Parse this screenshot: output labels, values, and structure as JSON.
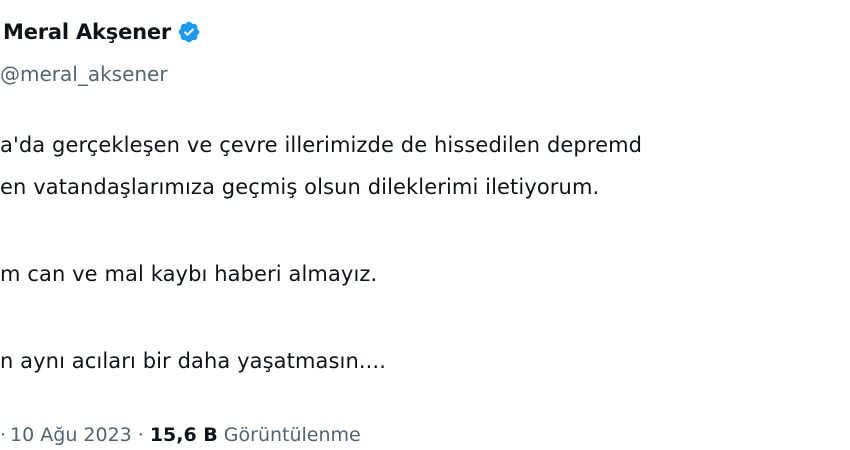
{
  "author": {
    "display_name": "Meral Akşener",
    "handle": "@meral_aksener",
    "verified_icon": "verified-badge-icon",
    "verified_color": "#1d9bf0"
  },
  "tweet": {
    "lines": [
      "a'da gerçekleşen ve çevre illerimizde de hissedilen depremd",
      "en vatandaşlarımıza geçmiş olsun dileklerimi iletiyorum.",
      "m can ve mal kaybı haberi almayız.",
      "n aynı acıları bir daha yaşatmasın...."
    ]
  },
  "meta": {
    "leading_dot": "·",
    "date": "10 Ağu 2023",
    "separator": "·",
    "views_count": "15,6 B",
    "views_label": "Görüntülenme"
  },
  "colors": {
    "text_primary": "#0f1419",
    "text_secondary": "#536471",
    "background": "#ffffff"
  }
}
